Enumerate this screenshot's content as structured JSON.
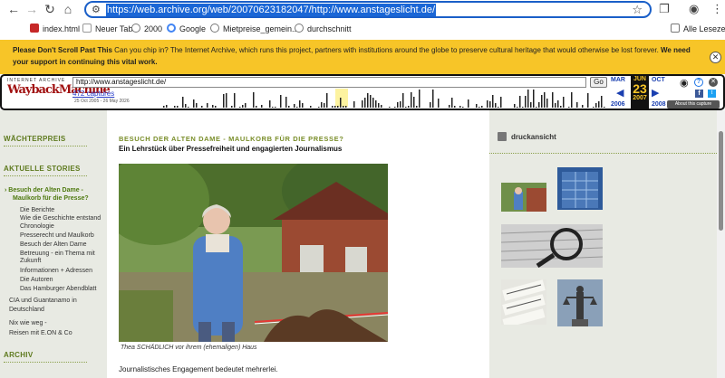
{
  "browser": {
    "url": "https://web.archive.org/web/20070623182047/http://www.anstageslicht.de/",
    "bookmarks": [
      {
        "label": "index.html",
        "color": "#c62828"
      },
      {
        "label": "Neuer Tab",
        "color": "#bdbdbd"
      },
      {
        "label": "2000",
        "color": "#e0e0e0"
      },
      {
        "label": "Google",
        "color": "#4285f4"
      },
      {
        "label": "Mietpreise_gemein...",
        "color": "#e0e0e0"
      },
      {
        "label": "durchschnitt",
        "color": "#e0e0e0"
      }
    ],
    "other_bookmarks": "Alle Lesezeichen"
  },
  "banner": {
    "bold_lead": "Please Don't Scroll Past This",
    "text": " Can you chip in? The Internet Archive, which runs this project, partners with institutions around the globe to preserve cultural heritage that would otherwise be lost forever. ",
    "bold_tail": "We need your support in continuing this vital work."
  },
  "wayback": {
    "logo_top": "INTERNET ARCHIVE",
    "logo_main": "WaybackMachine",
    "url_value": "http://www.anstageslicht.de/",
    "go": "Go",
    "captures": "472 captures",
    "range": "25 Oct 2005 - 26 May 2026",
    "prev_month": "MAR",
    "cur_month": "JUN",
    "cur_day": "23",
    "cur_year": "2007",
    "next_month": "OCT",
    "prev_year": "2006",
    "next_year": "2008",
    "about": "About this capture"
  },
  "left": {
    "section1": "WÄCHTERPREIS",
    "section2": "AKTUELLE STORIES",
    "active_story_line1": "Besuch der Alten Dame -",
    "active_story_line2": "Maulkorb für die Presse?",
    "sub_items": [
      "Die Berichte",
      "Wie die Geschichte entstand",
      "Chronologie",
      "Presserecht und Maulkorb",
      "Besuch der Alten Dame",
      "Betreuung - ein Thema mit",
      "Zukunft",
      "Informationen + Adressen",
      "Die Autoren",
      "Das Hamburger Abendblatt"
    ],
    "other1_line1": "CIA und Guantanamo in",
    "other1_line2": "Deutschland",
    "other2": "Nix wie weg -",
    "other3": "Reisen mit E.ON & Co",
    "section3": "ARCHIV"
  },
  "article": {
    "kicker": "BESUCH DER ALTEN DAME - MAULKORB FÜR DIE PRESSE?",
    "subtitle": "Ein Lehrstück über Pressefreiheit und engagierten Journalismus",
    "caption": "Thea SCHÄDLICH vor ihrem (ehemaligen) Haus",
    "body": "Journalistisches Engagement bedeutet mehrerlei."
  },
  "right": {
    "print": "druckansicht"
  }
}
